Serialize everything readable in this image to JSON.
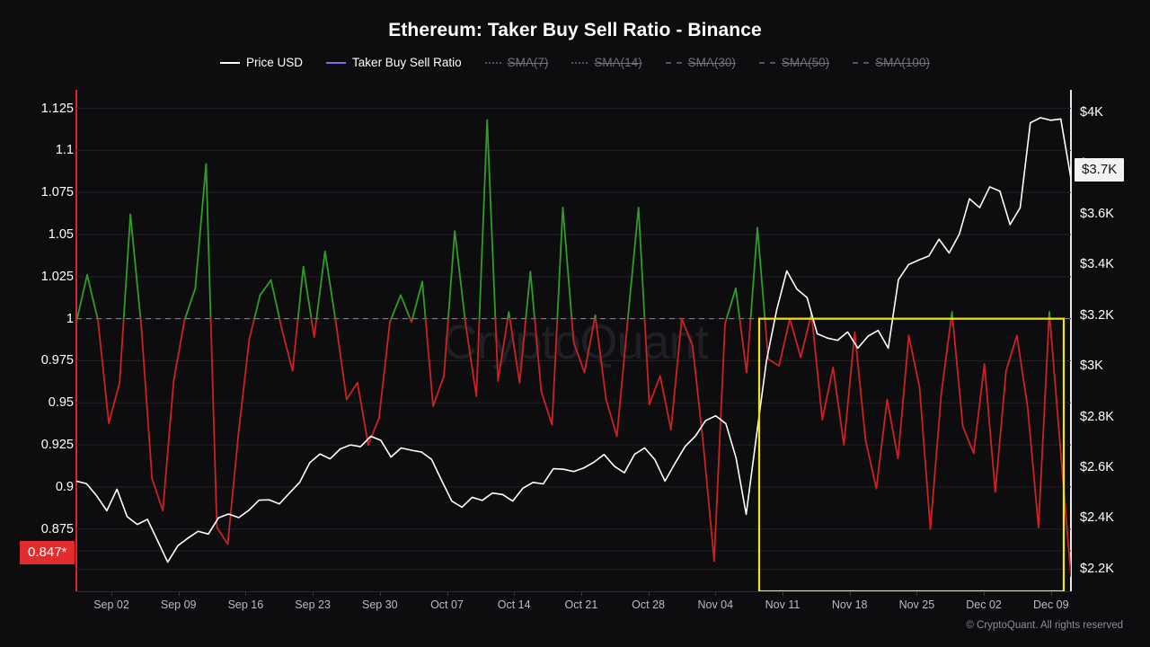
{
  "header": {
    "title": "Ethereum: Taker Buy Sell Ratio - Binance"
  },
  "footer": {
    "copyright": "© CryptoQuant. All rights reserved"
  },
  "watermark": {
    "text": "CryptoQuant"
  },
  "legend": [
    {
      "label": "Price USD",
      "color": "#ffffff",
      "style": "solid",
      "disabled": false
    },
    {
      "label": "Taker Buy Sell Ratio",
      "color": "#7b6cf6",
      "style": "solid",
      "disabled": false
    },
    {
      "label": "SMA(7)",
      "color": "#8c8f9a",
      "style": "dotted",
      "disabled": true
    },
    {
      "label": "SMA(14)",
      "color": "#8c8f9a",
      "style": "dotted",
      "disabled": true
    },
    {
      "label": "SMA(30)",
      "color": "#8c8f9a",
      "style": "dashed",
      "disabled": true
    },
    {
      "label": "SMA(50)",
      "color": "#8c8f9a",
      "style": "dashed",
      "disabled": true
    },
    {
      "label": "SMA(100)",
      "color": "#8c8f9a",
      "style": "dashed",
      "disabled": true
    }
  ],
  "badges": {
    "ratio_current": "0.847*",
    "price_current": "$3.7K"
  },
  "colors": {
    "background": "#0d0d0f",
    "ratio_above": "#2f9e27",
    "ratio_below": "#cc2222",
    "price_line": "#ffffff",
    "left_axis": "#d42a2a",
    "right_axis": "#e8e8ea",
    "grid": "#202227",
    "reference_line": "#8a8d96",
    "highlight_box": "#f2e318",
    "badge_ratio_bg": "#e12d2d",
    "badge_price_bg": "#f2f2f3"
  },
  "annotations": [
    {
      "type": "rect",
      "name": "highlight-box",
      "color": "#f2e318",
      "x_start": "Nov 09",
      "x_end": "Dec 10",
      "y_top": 1.0,
      "y_bottom": 0.838
    }
  ],
  "chart_data": {
    "type": "line",
    "title": "Ethereum: Taker Buy Sell Ratio - Binance",
    "xlabel": "",
    "grid": true,
    "legend_position": "top",
    "x_ticks": [
      "Sep 02",
      "Sep 09",
      "Sep 16",
      "Sep 23",
      "Sep 30",
      "Oct 07",
      "Oct 14",
      "Oct 21",
      "Oct 28",
      "Nov 04",
      "Nov 11",
      "Nov 18",
      "Nov 25",
      "Dec 02",
      "Dec 09"
    ],
    "axes": {
      "left": {
        "label": "Taker Buy Sell Ratio",
        "ticks": [
          1.125,
          1.1,
          1.075,
          1.05,
          1.025,
          1,
          0.975,
          0.95,
          0.925,
          0.9,
          0.875
        ],
        "tick_labels": [
          "1.125",
          "1.1",
          "1.075",
          "1.05",
          "1.025",
          "1",
          "0.975",
          "0.95",
          "0.925",
          "0.9",
          "0.875"
        ],
        "range": [
          0.838,
          1.136
        ]
      },
      "right": {
        "label": "Price USD",
        "ticks": [
          4000,
          3800,
          3600,
          3400,
          3200,
          3000,
          2800,
          2600,
          2400,
          2200
        ],
        "tick_labels": [
          "$4K",
          "$3.8K",
          "$3.6K",
          "$3.4K",
          "$3.2K",
          "$3K",
          "$2.8K",
          "$2.6K",
          "$2.4K",
          "$2.2K"
        ],
        "range": [
          2110,
          4090
        ]
      }
    },
    "reference_lines": [
      {
        "axis": "left",
        "value": 1.0,
        "style": "dashed",
        "color": "#8a8d96"
      }
    ],
    "series": [
      {
        "name": "Taker Buy Sell Ratio",
        "axis": "left",
        "color_above": "#2f9e27",
        "color_below": "#cc2222",
        "threshold": 1.0,
        "values": [
          0.998,
          1.026,
          0.999,
          0.938,
          0.962,
          1.062,
          0.996,
          0.905,
          0.886,
          0.963,
          0.999,
          1.018,
          1.092,
          0.876,
          0.866,
          0.932,
          0.988,
          1.014,
          1.023,
          0.994,
          0.969,
          1.031,
          0.989,
          1.04,
          0.998,
          0.952,
          0.962,
          0.925,
          0.941,
          0.998,
          1.014,
          0.998,
          1.022,
          0.948,
          0.966,
          1.052,
          0.997,
          0.954,
          1.118,
          0.963,
          1.004,
          0.962,
          1.028,
          0.957,
          0.937,
          1.066,
          0.986,
          0.968,
          1.002,
          0.952,
          0.93,
          0.999,
          1.066,
          0.949,
          0.966,
          0.934,
          1.0,
          0.984,
          0.925,
          0.856,
          0.997,
          1.018,
          0.968,
          1.054,
          0.976,
          0.972,
          1.0,
          0.977,
          1.003,
          0.94,
          0.971,
          0.925,
          0.992,
          0.928,
          0.899,
          0.952,
          0.917,
          0.99,
          0.959,
          0.875,
          0.955,
          1.004,
          0.936,
          0.92,
          0.973,
          0.897,
          0.969,
          0.99,
          0.947,
          0.876,
          1.004,
          0.925,
          0.847
        ]
      },
      {
        "name": "Price USD",
        "axis": "right",
        "color": "#ffffff",
        "values": [
          2545,
          2535,
          2487,
          2428,
          2513,
          2405,
          2374,
          2394,
          2310,
          2225,
          2290,
          2320,
          2347,
          2336,
          2400,
          2415,
          2401,
          2430,
          2470,
          2471,
          2455,
          2498,
          2540,
          2618,
          2652,
          2633,
          2672,
          2688,
          2681,
          2722,
          2706,
          2640,
          2676,
          2667,
          2660,
          2631,
          2547,
          2466,
          2442,
          2481,
          2469,
          2498,
          2492,
          2466,
          2517,
          2540,
          2534,
          2594,
          2592,
          2583,
          2597,
          2620,
          2650,
          2604,
          2578,
          2651,
          2676,
          2630,
          2545,
          2616,
          2683,
          2723,
          2784,
          2803,
          2772,
          2637,
          2414,
          2720,
          3020,
          3220,
          3375,
          3303,
          3270,
          3127,
          3110,
          3101,
          3134,
          3070,
          3117,
          3140,
          3070,
          3340,
          3400,
          3418,
          3434,
          3500,
          3446,
          3520,
          3660,
          3625,
          3707,
          3690,
          3558,
          3625,
          3960,
          3980,
          3970,
          3975,
          3740
        ]
      }
    ]
  }
}
